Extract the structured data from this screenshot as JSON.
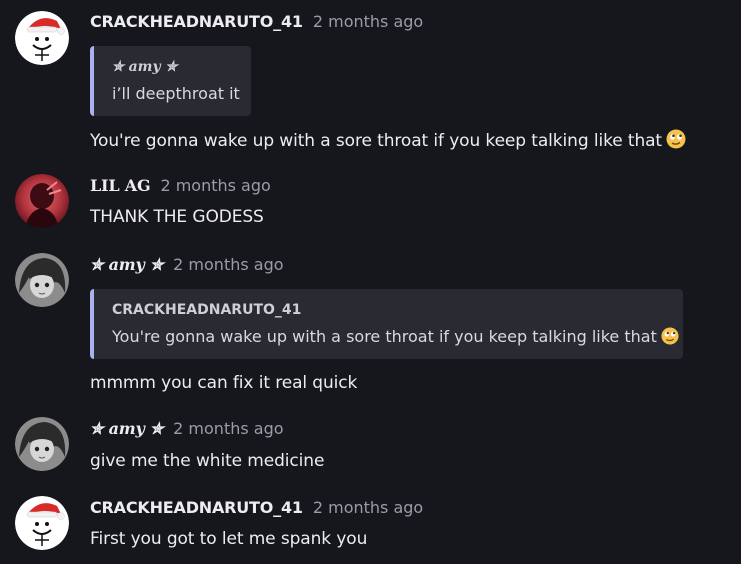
{
  "comments": [
    {
      "author": "CRACKHEADNARUTO_41",
      "time": "2 months ago",
      "avatar_icon": "santa-meme-face-icon",
      "quote": {
        "author": "✮ 𝒂𝒎𝒚 ✮",
        "text": "i’ll deepthroat it"
      },
      "text": "You're gonna wake up with a sore throat if you keep talking like that",
      "emoji": "face-with-rolling-eyes-emoji"
    },
    {
      "author": "LIL AG",
      "time": "2 months ago",
      "avatar_icon": "red-profile-photo-icon",
      "text": "THANK THE GODESS"
    },
    {
      "author": "✮ 𝒂𝒎𝒚 ✮",
      "time": "2 months ago",
      "avatar_icon": "anime-girl-avatar-icon",
      "quote": {
        "author": "CRACKHEADNARUTO_41",
        "text": "You're gonna wake up with a sore throat if you keep talking like that"
      },
      "quote_emoji": "face-with-rolling-eyes-emoji",
      "text": "mmmm you can fix it real quick"
    },
    {
      "author": "✮ 𝒂𝒎𝒚 ✮",
      "time": "2 months ago",
      "avatar_icon": "anime-girl-avatar-icon",
      "text": "give me the white medicine"
    },
    {
      "author": "CRACKHEADNARUTO_41",
      "time": "2 months ago",
      "avatar_icon": "santa-meme-face-icon",
      "text": "First you got to let me spank you"
    }
  ],
  "colors": {
    "background": "#16161d",
    "quote_background": "#2a2a32",
    "quote_accent": "#aab2ee",
    "timestamp": "#9c9ca6"
  }
}
